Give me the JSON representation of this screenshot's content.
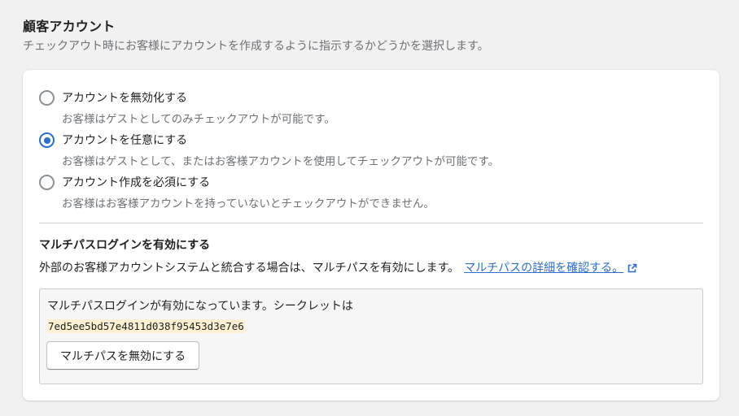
{
  "section": {
    "title": "顧客アカウント",
    "description": "チェックアウト時にお客様にアカウントを作成するように指示するかどうかを選択します。"
  },
  "account_options": [
    {
      "label": "アカウントを無効化する",
      "help": "お客様はゲストとしてのみチェックアウトが可能です。",
      "selected": false
    },
    {
      "label": "アカウントを任意にする",
      "help": "お客様はゲストとして、またはお客様アカウントを使用してチェックアウトが可能です。",
      "selected": true
    },
    {
      "label": "アカウント作成を必須にする",
      "help": "お客様はお客様アカウントを持っていないとチェックアウトができません。",
      "selected": false
    }
  ],
  "multipass": {
    "title": "マルチパスログインを有効にする",
    "description": "外部のお客様アカウントシステムと統合する場合は、マルチパスを有効にします。",
    "link_label": "マルチパスの詳細を確認する。",
    "enabled_message": "マルチパスログインが有効になっています。シークレットは",
    "secret": "7ed5ee5bd57e4811d038f95453d3e7e6",
    "disable_button_label": "マルチパスを無効にする"
  },
  "colors": {
    "accent": "#2c6ecb",
    "secret_highlight": "#fdf0d2"
  },
  "icons": {
    "external_link": "external-link-icon"
  }
}
